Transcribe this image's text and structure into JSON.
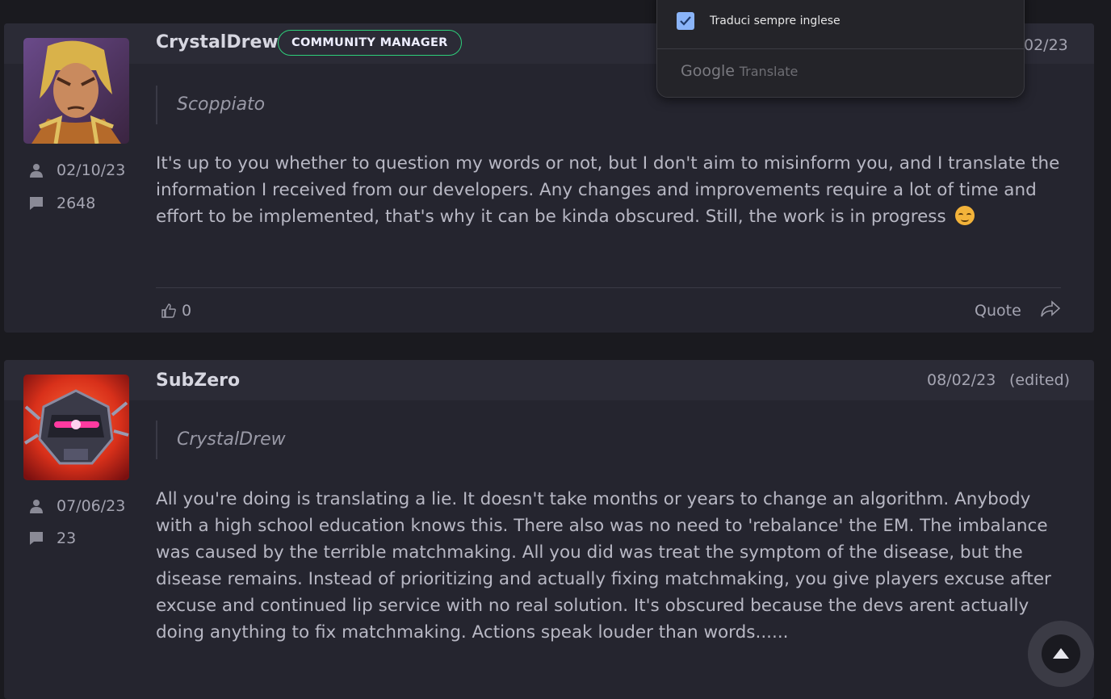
{
  "posts": [
    {
      "author": "CrystalDrew",
      "badge": "COMMUNITY MANAGER",
      "date": "02/23",
      "edited": "",
      "join_date": "02/10/23",
      "post_count": "2648",
      "quoted_author": "Scoppiato",
      "body": "It's up to you whether to question my words or not, but I don't aim to misinform you, and I translate the information I received from our developers. Any changes and improvements require a lot of time and effort to be implemented, that's why it can be kinda obscured. Still, the work is in progress",
      "likes": "0",
      "quote_label": "Quote"
    },
    {
      "author": "SubZero",
      "date": "08/02/23",
      "edited": "(edited)",
      "join_date": "07/06/23",
      "post_count": "23",
      "quoted_author": "CrystalDrew",
      "body": "All you're doing is translating a lie. It doesn't take months or years to change an algorithm. Anybody with a high school education knows this. There also was no need to 'rebalance' the EM. The imbalance was caused by the terrible matchmaking. All you did was treat the symptom of the disease, but the disease remains. Instead of prioritizing and actually fixing matchmaking, you give players excuse after excuse and continued lip service with no real solution. It's obscured because the devs arent actually doing anything to fix matchmaking. Actions speak louder than words......"
    }
  ],
  "translate_popup": {
    "checkbox_label": "Traduci sempre inglese",
    "checked": true,
    "brand_google": "Google",
    "brand_translate": "Translate"
  },
  "colors": {
    "badge_border": "#2ecf7b",
    "checkbox": "#8ab4f8",
    "emoji": "#f3b33a"
  },
  "icons": [
    "user-icon",
    "comment-icon",
    "thumbs-up-icon",
    "share-icon",
    "smiley-icon",
    "check-icon",
    "arrow-up-icon"
  ]
}
